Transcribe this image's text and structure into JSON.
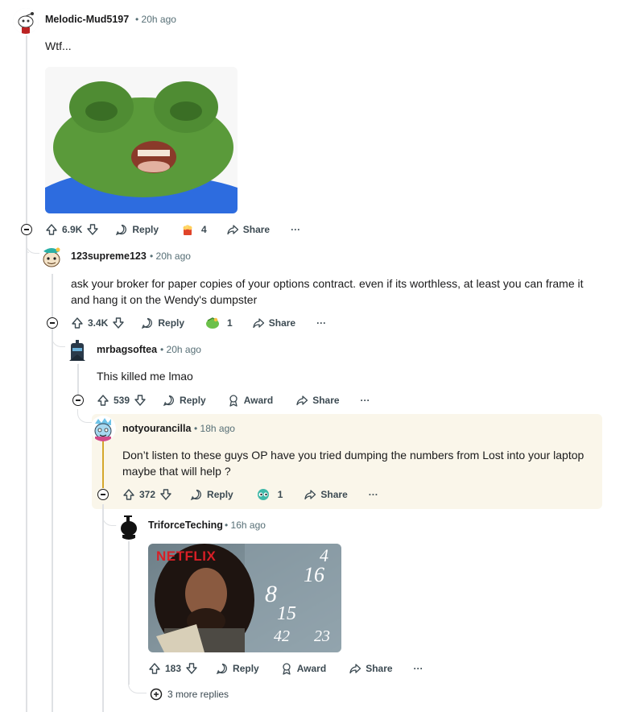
{
  "comments": [
    {
      "username": "Melodic-Mud5197",
      "time": "20h ago",
      "text": "Wtf...",
      "image_alt": "Pepe frog reaction image",
      "votes": "6.9K",
      "reply_label": "Reply",
      "award_count": "4",
      "share_label": "Share",
      "more_label": "···"
    },
    {
      "username": "123supreme123",
      "time": "20h ago",
      "text_line1": "ask your broker for paper copies of your options contract. even if its worthless, at least you can frame it",
      "text_line2": "and hang it on the Wendy's dumpster",
      "votes": "3.4K",
      "reply_label": "Reply",
      "award_count": "1",
      "share_label": "Share",
      "more_label": "···"
    },
    {
      "username": "mrbagsoftea",
      "time": "20h ago",
      "text": "This killed me lmao",
      "votes": "539",
      "reply_label": "Reply",
      "award_label": "Award",
      "share_label": "Share",
      "more_label": "···"
    },
    {
      "username": "notyourancilla",
      "time": "18h ago",
      "text_line1": "Don’t listen to these guys OP have you tried dumping the numbers from Lost into your laptop",
      "text_line2": "maybe that will help ?",
      "votes": "372",
      "reply_label": "Reply",
      "award_count": "1",
      "share_label": "Share",
      "more_label": "···"
    },
    {
      "username": "TriforceTeching",
      "time": "16h ago",
      "image_brand": "NETFLIX",
      "image_numbers": [
        "4",
        "8",
        "15",
        "16",
        "23",
        "42"
      ],
      "votes": "183",
      "reply_label": "Reply",
      "award_label": "Award",
      "share_label": "Share",
      "more_label": "···"
    }
  ],
  "more_replies_label": "3 more replies",
  "meta_separator": "•",
  "colors": {
    "thread_line": "#dfe1e4",
    "highlight_bg": "#faf6ea",
    "highlight_line": "#d4a72c",
    "meta_text": "#576f76"
  }
}
